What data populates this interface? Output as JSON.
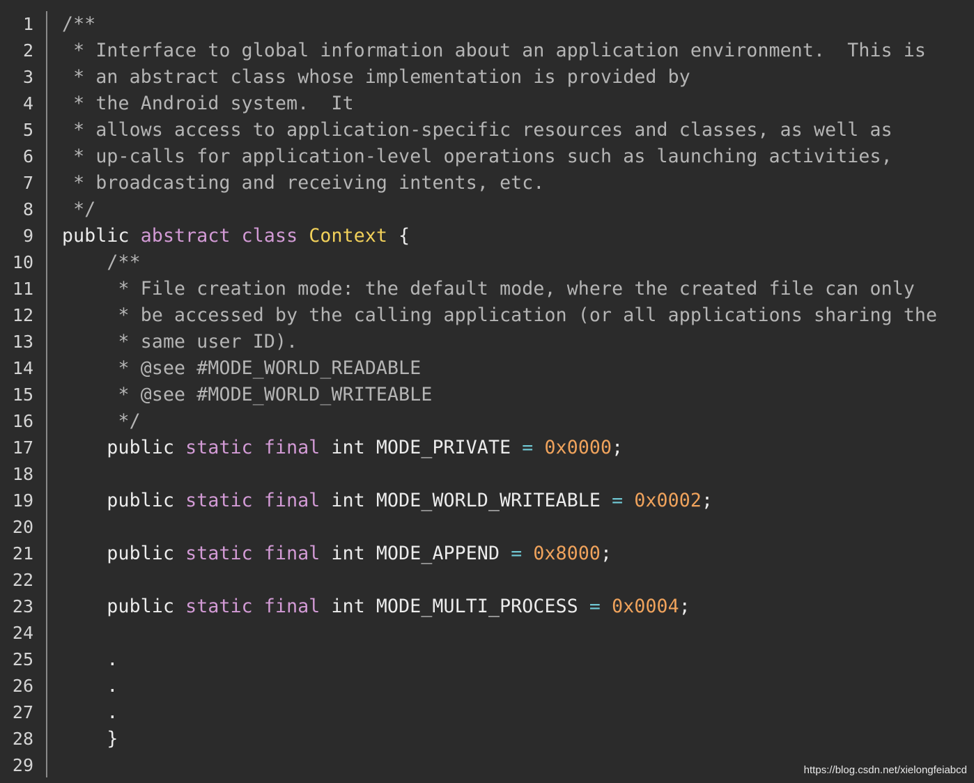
{
  "editor": {
    "language": "java",
    "line_numbers": [
      "1",
      "2",
      "3",
      "4",
      "5",
      "6",
      "7",
      "8",
      "9",
      "10",
      "11",
      "12",
      "13",
      "14",
      "15",
      "16",
      "17",
      "18",
      "19",
      "20",
      "21",
      "22",
      "23",
      "24",
      "25",
      "26",
      "27",
      "28",
      "29"
    ],
    "lines": [
      [
        {
          "t": "/**",
          "c": "c"
        }
      ],
      [
        {
          "t": " * Interface to global information about an application environment.  This is",
          "c": "c"
        }
      ],
      [
        {
          "t": " * an abstract class whose implementation is provided by",
          "c": "c"
        }
      ],
      [
        {
          "t": " * the Android system.  It",
          "c": "c"
        }
      ],
      [
        {
          "t": " * allows access to application-specific resources and classes, as well as",
          "c": "c"
        }
      ],
      [
        {
          "t": " * up-calls for application-level operations such as launching activities,",
          "c": "c"
        }
      ],
      [
        {
          "t": " * broadcasting and receiving intents, etc.",
          "c": "c"
        }
      ],
      [
        {
          "t": " */",
          "c": "c"
        }
      ],
      [
        {
          "t": "public ",
          "c": "p"
        },
        {
          "t": "abstract class ",
          "c": "k"
        },
        {
          "t": "Context",
          "c": "t"
        },
        {
          "t": " {",
          "c": "p"
        }
      ],
      [
        {
          "t": "    /**",
          "c": "c"
        }
      ],
      [
        {
          "t": "     * File creation mode: the default mode, where the created file can only",
          "c": "c"
        }
      ],
      [
        {
          "t": "     * be accessed by the calling application (or all applications sharing the",
          "c": "c"
        }
      ],
      [
        {
          "t": "     * same user ID).",
          "c": "c"
        }
      ],
      [
        {
          "t": "     * @see #MODE_WORLD_READABLE",
          "c": "c"
        }
      ],
      [
        {
          "t": "     * @see #MODE_WORLD_WRITEABLE",
          "c": "c"
        }
      ],
      [
        {
          "t": "     */",
          "c": "c"
        }
      ],
      [
        {
          "t": "    public ",
          "c": "p"
        },
        {
          "t": "static final ",
          "c": "k"
        },
        {
          "t": "int MODE_PRIVATE ",
          "c": "p"
        },
        {
          "t": "=",
          "c": "o"
        },
        {
          "t": " ",
          "c": "p"
        },
        {
          "t": "0x0000",
          "c": "n"
        },
        {
          "t": ";",
          "c": "p"
        }
      ],
      [
        {
          "t": "",
          "c": "p"
        }
      ],
      [
        {
          "t": "    public ",
          "c": "p"
        },
        {
          "t": "static final ",
          "c": "k"
        },
        {
          "t": "int MODE_WORLD_WRITEABLE ",
          "c": "p"
        },
        {
          "t": "=",
          "c": "o"
        },
        {
          "t": " ",
          "c": "p"
        },
        {
          "t": "0x0002",
          "c": "n"
        },
        {
          "t": ";",
          "c": "p"
        }
      ],
      [
        {
          "t": "",
          "c": "p"
        }
      ],
      [
        {
          "t": "    public ",
          "c": "p"
        },
        {
          "t": "static final ",
          "c": "k"
        },
        {
          "t": "int MODE_APPEND ",
          "c": "p"
        },
        {
          "t": "=",
          "c": "o"
        },
        {
          "t": " ",
          "c": "p"
        },
        {
          "t": "0x8000",
          "c": "n"
        },
        {
          "t": ";",
          "c": "p"
        }
      ],
      [
        {
          "t": "",
          "c": "p"
        }
      ],
      [
        {
          "t": "    public ",
          "c": "p"
        },
        {
          "t": "static final ",
          "c": "k"
        },
        {
          "t": "int MODE_MULTI_PROCESS ",
          "c": "p"
        },
        {
          "t": "=",
          "c": "o"
        },
        {
          "t": " ",
          "c": "p"
        },
        {
          "t": "0x0004",
          "c": "n"
        },
        {
          "t": ";",
          "c": "p"
        }
      ],
      [
        {
          "t": "",
          "c": "p"
        }
      ],
      [
        {
          "t": "    .",
          "c": "p"
        }
      ],
      [
        {
          "t": "    .",
          "c": "p"
        }
      ],
      [
        {
          "t": "    .",
          "c": "p"
        }
      ],
      [
        {
          "t": "    }",
          "c": "p"
        }
      ],
      [
        {
          "t": "",
          "c": "p"
        }
      ]
    ]
  },
  "colors": {
    "background": "#2b2b2b",
    "comment": "#b5b5b5",
    "keyword": "#d39bd6",
    "type_name": "#f2d15a",
    "number": "#f0a35c",
    "operator": "#6fc6d2",
    "plain": "#ececec",
    "gutter_text": "#d4d4d4",
    "gutter_border": "#8a8a8a"
  },
  "watermark": "https://blog.csdn.net/xielongfeiabcd"
}
